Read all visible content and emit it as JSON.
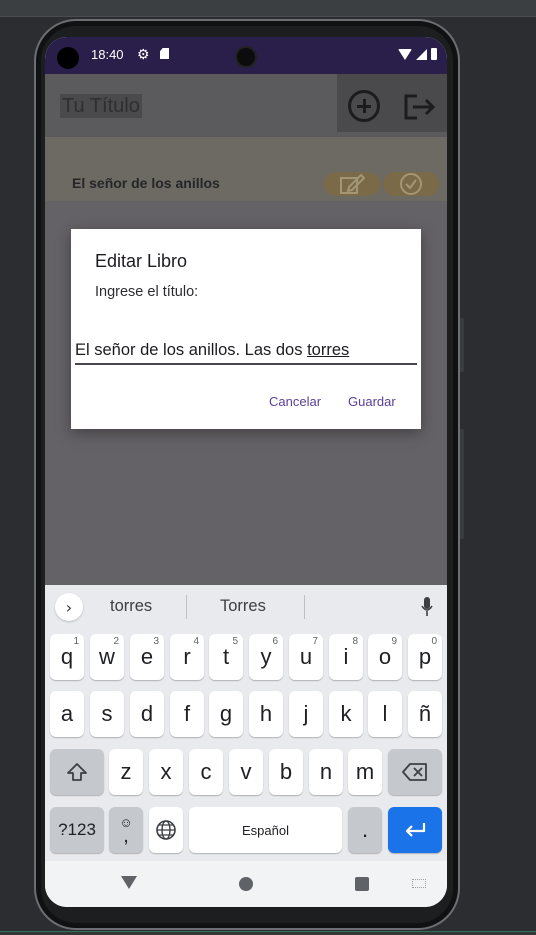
{
  "status_bar": {
    "time": "18:40"
  },
  "app_bar": {
    "title": "Tu Título"
  },
  "list": {
    "items": [
      {
        "title": "El señor de  los anillos"
      }
    ]
  },
  "dialog": {
    "title": "Editar Libro",
    "message": "Ingrese el título:",
    "input_value_prefix": "El señor de los anillos. Las dos ",
    "input_value_underlined": "torres",
    "cancel_label": "Cancelar",
    "save_label": "Guardar"
  },
  "keyboard": {
    "suggestions": [
      "torres",
      "Torres"
    ],
    "row1": [
      {
        "k": "q",
        "n": "1"
      },
      {
        "k": "w",
        "n": "2"
      },
      {
        "k": "e",
        "n": "3"
      },
      {
        "k": "r",
        "n": "4"
      },
      {
        "k": "t",
        "n": "5"
      },
      {
        "k": "y",
        "n": "6"
      },
      {
        "k": "u",
        "n": "7"
      },
      {
        "k": "i",
        "n": "8"
      },
      {
        "k": "o",
        "n": "9"
      },
      {
        "k": "p",
        "n": "0"
      }
    ],
    "row2": [
      "a",
      "s",
      "d",
      "f",
      "g",
      "h",
      "j",
      "k",
      "l",
      "ñ"
    ],
    "row3": [
      "z",
      "x",
      "c",
      "v",
      "b",
      "n",
      "m"
    ],
    "symbols_label": "?123",
    "comma_label": ",",
    "space_label": "Español",
    "period_label": "."
  },
  "colors": {
    "accent": "#5a3f9a",
    "status_bar": "#2a1f4b",
    "enter_key": "#1a73e8"
  },
  "icons": [
    "settings-icon",
    "sd-card-icon",
    "wifi-icon",
    "signal-icon",
    "battery-icon",
    "add-circle-icon",
    "logout-icon",
    "edit-icon",
    "check-circle-icon",
    "chevron-right-icon",
    "mic-icon",
    "shift-icon",
    "backspace-icon",
    "emoji-icon",
    "globe-icon",
    "enter-icon",
    "nav-back-icon",
    "nav-home-icon",
    "nav-recents-icon",
    "keyboard-switch-icon"
  ]
}
